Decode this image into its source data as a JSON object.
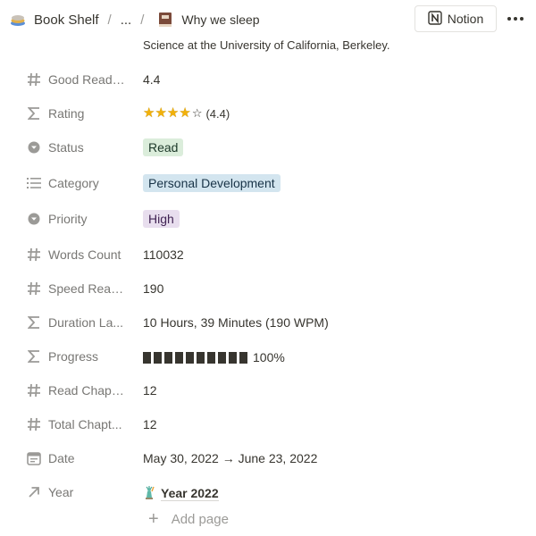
{
  "topbar": {
    "workspace_label": "Book Shelf",
    "ellipsis_label": "...",
    "page_title": "Why we sleep",
    "notion_button_label": "Notion"
  },
  "description": "Science at the University of California, Berkeley.",
  "properties": {
    "good_reads": {
      "label": "Good Read ...",
      "value": "4.4"
    },
    "rating": {
      "label": "Rating",
      "stars_full": 4,
      "stars_max": 5,
      "value_text": "(4.4)"
    },
    "status": {
      "label": "Status",
      "value": "Read",
      "color": "#dbeddb",
      "text_color": "#1c3829"
    },
    "category": {
      "label": "Category",
      "value": "Personal Development",
      "color": "#d3e5ef",
      "text_color": "#183347"
    },
    "priority": {
      "label": "Priority",
      "value": "High",
      "color": "#e8deee",
      "text_color": "#412454"
    },
    "words_count": {
      "label": "Words Count",
      "value": "110032"
    },
    "speed_read": {
      "label": "Speed Read...",
      "value": "190"
    },
    "duration": {
      "label": "Duration La...",
      "value": "10 Hours, 39 Minutes (190 WPM)"
    },
    "progress": {
      "label": "Progress",
      "blocks": 10,
      "fraction": 1.0,
      "value_text": "100%"
    },
    "read_chapters": {
      "label": "Read Chapt...",
      "value": "12"
    },
    "total_chapters": {
      "label": "Total Chapt...",
      "value": "12"
    },
    "date": {
      "label": "Date",
      "value": "May 30, 2022 → June 23, 2022"
    },
    "year": {
      "label": "Year",
      "value": "Year 2022",
      "icon": "statue-of-liberty-icon"
    }
  },
  "add_page_label": "Add page"
}
